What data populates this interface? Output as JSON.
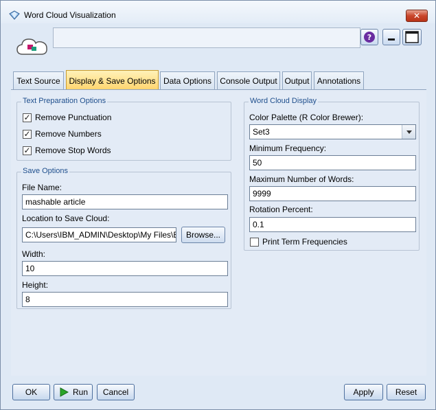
{
  "window": {
    "title": "Word Cloud Visualization",
    "close_label": "✕"
  },
  "header": {
    "help_icon": "help-icon",
    "minimize_icon": "minimize-icon",
    "maximize_icon": "maximize-icon"
  },
  "tabs": [
    {
      "label": "Text Source"
    },
    {
      "label": "Display & Save Options"
    },
    {
      "label": "Data Options"
    },
    {
      "label": "Console Output"
    },
    {
      "label": "Output"
    },
    {
      "label": "Annotations"
    }
  ],
  "text_prep": {
    "legend": "Text Preparation Options",
    "options": [
      {
        "label": "Remove Punctuation",
        "checked": true
      },
      {
        "label": "Remove Numbers",
        "checked": true
      },
      {
        "label": "Remove Stop Words",
        "checked": true
      }
    ]
  },
  "save": {
    "legend": "Save Options",
    "file_name_label": "File Name:",
    "file_name_value": "mashable article",
    "location_label": "Location to Save Cloud:",
    "location_value": "C:\\Users\\IBM_ADMIN\\Desktop\\My Files\\E",
    "browse_label": "Browse...",
    "width_label": "Width:",
    "width_value": "10",
    "height_label": "Height:",
    "height_value": "8"
  },
  "display": {
    "legend": "Word Cloud Display",
    "palette_label": "Color Palette (R Color Brewer):",
    "palette_value": "Set3",
    "min_freq_label": "Minimum Frequency:",
    "min_freq_value": "50",
    "max_words_label": "Maximum Number of Words:",
    "max_words_value": "9999",
    "rotation_label": "Rotation Percent:",
    "rotation_value": "0.1",
    "print_freq_label": "Print Term Frequencies",
    "print_freq_checked": false
  },
  "buttons": {
    "ok": "OK",
    "run": "Run",
    "cancel": "Cancel",
    "apply": "Apply",
    "reset": "Reset"
  },
  "colors": {
    "active_tab": "#ffd36b",
    "legend_text": "#1e4e8c",
    "run_arrow": "#2aa52a"
  }
}
